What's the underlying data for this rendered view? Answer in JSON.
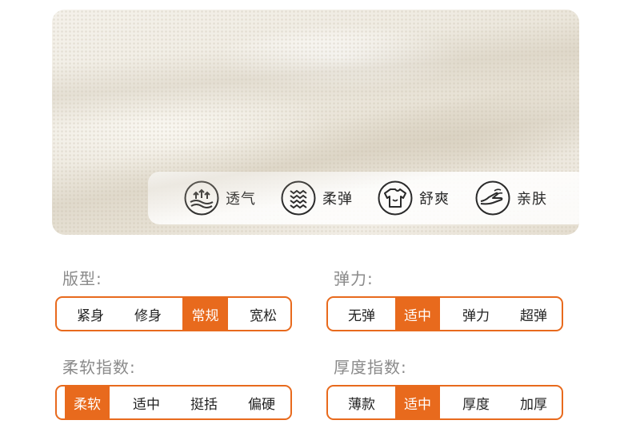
{
  "features": [
    {
      "icon": "breathable-icon",
      "label": "透气"
    },
    {
      "icon": "elastic-icon",
      "label": "柔弹"
    },
    {
      "icon": "shirt-icon",
      "label": "舒爽"
    },
    {
      "icon": "skin-hand-icon",
      "label": "亲肤"
    }
  ],
  "attributes": [
    {
      "title": "版型:",
      "options": [
        "紧身",
        "修身",
        "常规",
        "宽松"
      ],
      "selected": "常规"
    },
    {
      "title": "弹力:",
      "options": [
        "无弹",
        "适中",
        "弹力",
        "超弹"
      ],
      "selected": "适中"
    },
    {
      "title": "柔软指数:",
      "options": [
        "柔软",
        "适中",
        "挺括",
        "偏硬"
      ],
      "selected": "柔软"
    },
    {
      "title": "厚度指数:",
      "options": [
        "薄款",
        "适中",
        "厚度",
        "加厚"
      ],
      "selected": "适中"
    }
  ],
  "colors": {
    "accent": "#e86a1d",
    "label_gray": "#8a8a8a",
    "icon_dark": "#2a2a2a"
  }
}
